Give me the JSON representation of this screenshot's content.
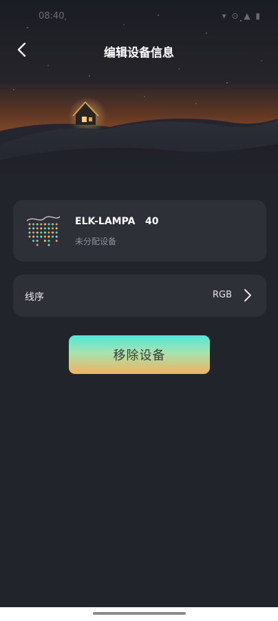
{
  "status_bar": {
    "time": "08:40",
    "icons": "▾ ⊙ ▲ ▮"
  },
  "header": {
    "title": "编辑设备信息",
    "back_icon": "chevron-left-icon"
  },
  "device": {
    "name": "ELK-LAMPA   40",
    "status": "未分配设备",
    "icon": "curtain-light-icon"
  },
  "wire_order": {
    "label": "线序",
    "value": "RGB",
    "icon": "chevron-right-icon"
  },
  "actions": {
    "remove_label": "移除设备"
  },
  "colors": {
    "background": "#22242b",
    "card": "#2e3038",
    "button_gradient_top": "#52e6da",
    "button_gradient_bottom": "#f2b25e"
  }
}
